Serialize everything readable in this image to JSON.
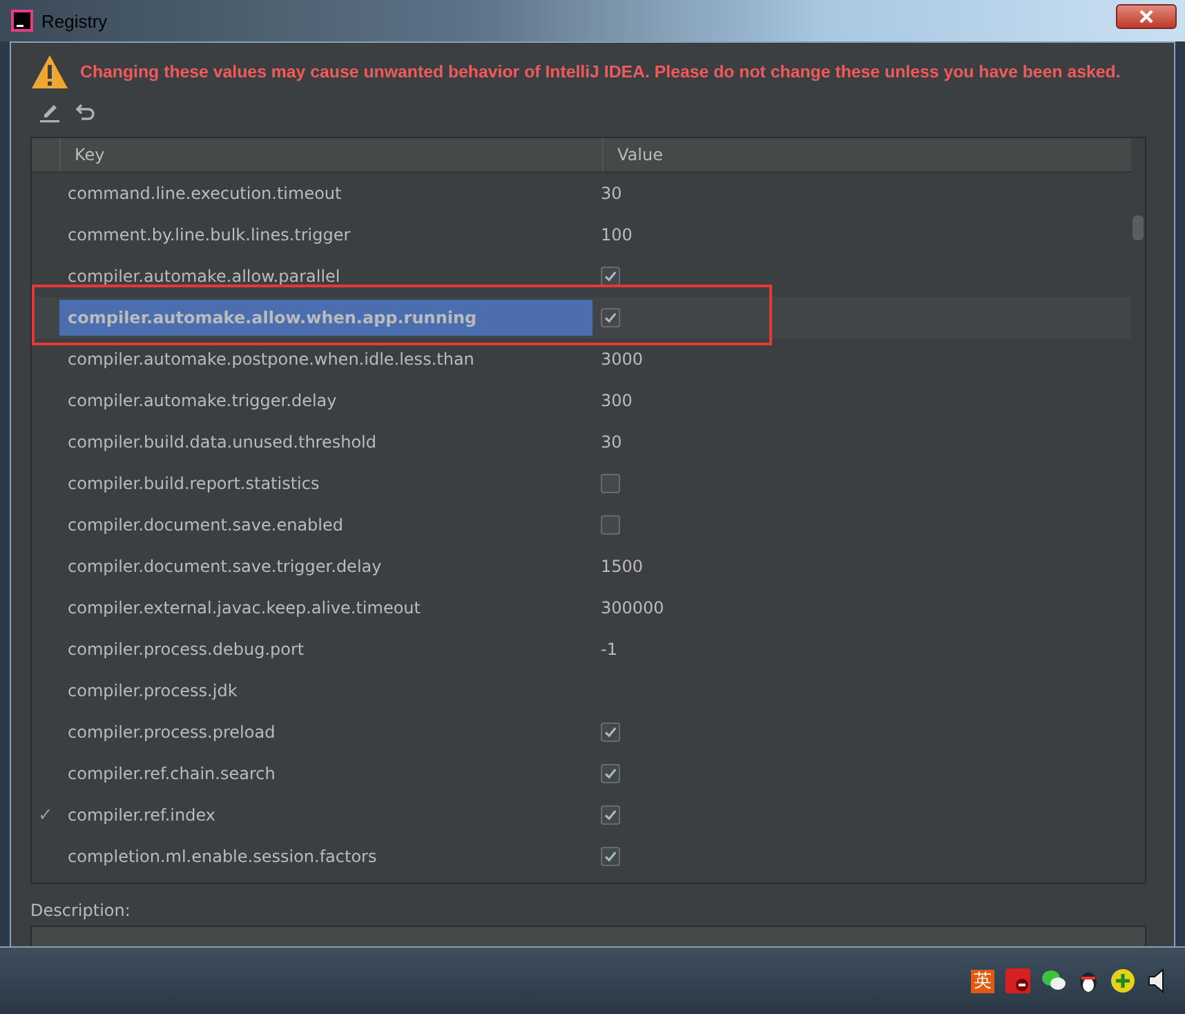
{
  "window": {
    "title": "Registry"
  },
  "warning": "Changing these values may cause unwanted behavior of IntelliJ IDEA. Please do not change these unless you have been asked.",
  "table": {
    "columns": [
      "Key",
      "Value"
    ],
    "rows": [
      {
        "key": "command.line.execution.timeout",
        "kind": "text",
        "value": "30",
        "selected": false,
        "changed": false,
        "highlighted": false
      },
      {
        "key": "comment.by.line.bulk.lines.trigger",
        "kind": "text",
        "value": "100",
        "selected": false,
        "changed": false,
        "highlighted": false
      },
      {
        "key": "compiler.automake.allow.parallel",
        "kind": "checkbox",
        "checked": true,
        "selected": false,
        "changed": false,
        "highlighted": false
      },
      {
        "key": "compiler.automake.allow.when.app.running",
        "kind": "checkbox",
        "checked": true,
        "selected": true,
        "changed": true,
        "highlighted": true
      },
      {
        "key": "compiler.automake.postpone.when.idle.less.than",
        "kind": "text",
        "value": "3000",
        "selected": false,
        "changed": false,
        "highlighted": false
      },
      {
        "key": "compiler.automake.trigger.delay",
        "kind": "text",
        "value": "300",
        "selected": false,
        "changed": false,
        "highlighted": false
      },
      {
        "key": "compiler.build.data.unused.threshold",
        "kind": "text",
        "value": "30",
        "selected": false,
        "changed": false,
        "highlighted": false
      },
      {
        "key": "compiler.build.report.statistics",
        "kind": "checkbox",
        "checked": false,
        "selected": false,
        "changed": false,
        "highlighted": false
      },
      {
        "key": "compiler.document.save.enabled",
        "kind": "checkbox",
        "checked": false,
        "selected": false,
        "changed": false,
        "highlighted": false
      },
      {
        "key": "compiler.document.save.trigger.delay",
        "kind": "text",
        "value": "1500",
        "selected": false,
        "changed": false,
        "highlighted": false
      },
      {
        "key": "compiler.external.javac.keep.alive.timeout",
        "kind": "text",
        "value": "300000",
        "selected": false,
        "changed": false,
        "highlighted": false
      },
      {
        "key": "compiler.process.debug.port",
        "kind": "text",
        "value": "-1",
        "selected": false,
        "changed": false,
        "highlighted": false
      },
      {
        "key": "compiler.process.jdk",
        "kind": "empty",
        "selected": false,
        "changed": false,
        "highlighted": false
      },
      {
        "key": "compiler.process.preload",
        "kind": "checkbox",
        "checked": true,
        "selected": false,
        "changed": false,
        "highlighted": false
      },
      {
        "key": "compiler.ref.chain.search",
        "kind": "checkbox",
        "checked": true,
        "selected": false,
        "changed": false,
        "highlighted": false
      },
      {
        "key": "compiler.ref.index",
        "kind": "checkbox",
        "checked": true,
        "selected": false,
        "changed": false,
        "highlighted": false,
        "marker": "✓"
      },
      {
        "key": "completion.ml.enable.session.factors",
        "kind": "checkbox",
        "checked": true,
        "selected": false,
        "changed": false,
        "highlighted": false
      }
    ]
  },
  "description": {
    "label": "Description:"
  },
  "taskbar": {
    "input_method": "英"
  }
}
